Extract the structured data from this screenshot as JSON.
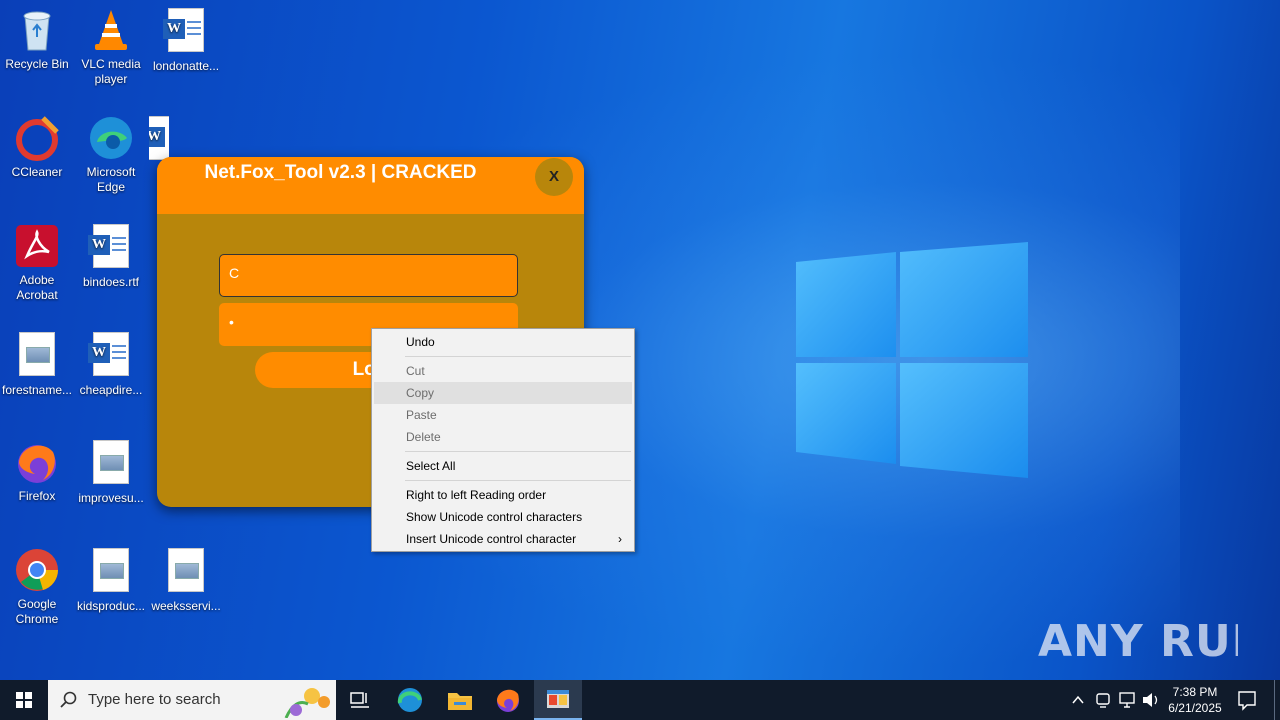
{
  "desktop": {
    "icons": [
      {
        "label": "Recycle Bin"
      },
      {
        "label": "VLC media player"
      },
      {
        "label": "londonatte..."
      },
      {
        "label": "CCleaner"
      },
      {
        "label": "Microsoft Edge"
      },
      {
        "label": "Adobe Acrobat"
      },
      {
        "label": "bindoes.rtf"
      },
      {
        "label": "forestname..."
      },
      {
        "label": "cheapdire..."
      },
      {
        "label": "Firefox"
      },
      {
        "label": "improvesu..."
      },
      {
        "label": "Google Chrome"
      },
      {
        "label": "kidsproduc..."
      },
      {
        "label": "weeksservi..."
      }
    ]
  },
  "app": {
    "title": "Net.Fox_Tool v2.3 | CRACKED",
    "close_label": "X",
    "username_value": "C",
    "password_value": "•",
    "login_label": "Log",
    "colors": {
      "header": "#ff8c00",
      "body": "#b8860b"
    }
  },
  "context_menu": {
    "items": [
      {
        "label": "Undo",
        "enabled": true
      },
      {
        "label": "Cut",
        "enabled": false
      },
      {
        "label": "Copy",
        "enabled": false,
        "hovered": true
      },
      {
        "label": "Paste",
        "enabled": false
      },
      {
        "label": "Delete",
        "enabled": false
      },
      {
        "label": "Select All",
        "enabled": true
      },
      {
        "label": "Right to left Reading order",
        "enabled": true
      },
      {
        "label": "Show Unicode control characters",
        "enabled": true
      },
      {
        "label": "Insert Unicode control character",
        "enabled": true,
        "submenu": true
      }
    ],
    "submenu_arrow": "›"
  },
  "taskbar": {
    "search_placeholder": "Type here to search",
    "apps": [
      "task-view-icon",
      "edge-icon",
      "file-explorer-icon",
      "firefox-icon",
      "net-fox-tool-icon"
    ],
    "clock": {
      "time": "7:38 PM",
      "date": "6/21/2025"
    }
  },
  "watermark": "ANY RUN"
}
